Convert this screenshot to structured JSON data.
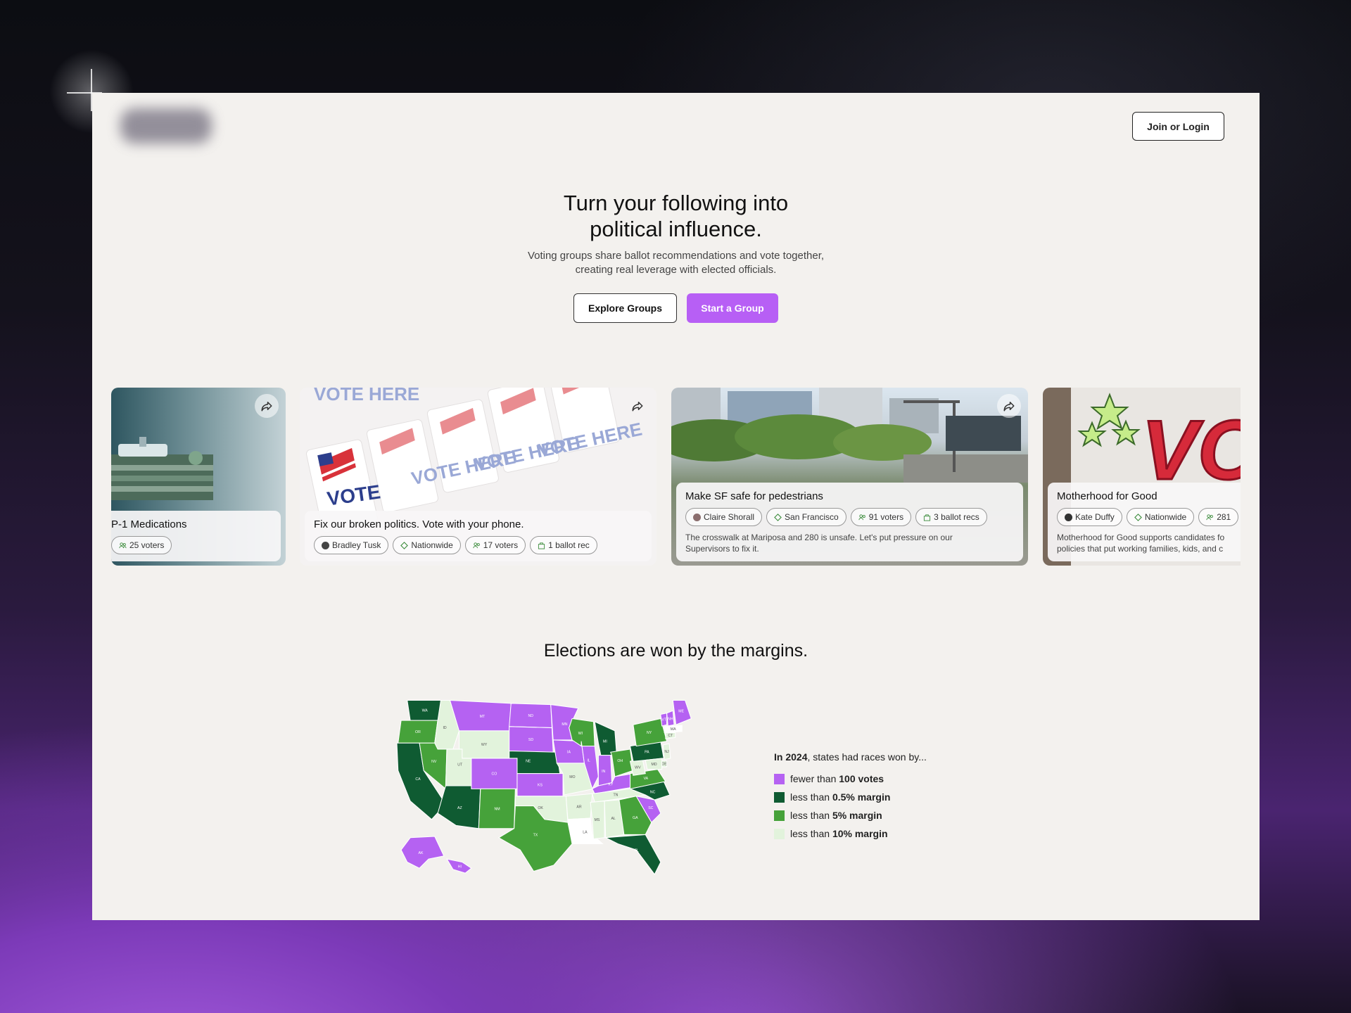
{
  "header": {
    "join_label": "Join or Login"
  },
  "hero": {
    "title_line1": "Turn your following into",
    "title_line2": "political influence.",
    "subtitle_line1": "Voting groups share ballot recommendations and vote together,",
    "subtitle_line2": "creating real leverage with elected officials.",
    "explore_label": "Explore Groups",
    "start_label": "Start a Group"
  },
  "cards": [
    {
      "title": "P-1 Medications",
      "tags": [
        "25 voters"
      ]
    },
    {
      "title": "Fix our broken politics. Vote with your phone.",
      "tags": [
        "Bradley Tusk",
        "Nationwide",
        "17 voters",
        "1 ballot rec"
      ]
    },
    {
      "title": "Make SF safe for pedestrians",
      "tags": [
        "Claire Shorall",
        "San Francisco",
        "91 voters",
        "3 ballot recs"
      ],
      "desc_line1": "The crosswalk at Mariposa and 280 is unsafe. Let's put pressure on our",
      "desc_line2": "Supervisors to fix it."
    },
    {
      "title": "Motherhood for Good",
      "tags": [
        "Kate Duffy",
        "Nationwide",
        "281"
      ],
      "desc_line1": "Motherhood for Good supports candidates fo",
      "desc_line2": "policies that put working families, kids, and c"
    }
  ],
  "vote_here": "VOTE HERE",
  "map_section": {
    "title": "Elections are won by the margins.",
    "legend_year": "In 2024",
    "legend_rest": ", states had races won by...",
    "legend": [
      {
        "prefix": "fewer than ",
        "bold": "100 votes",
        "color": "#b562f2"
      },
      {
        "prefix": "less than ",
        "bold": "0.5% margin",
        "color": "#0f5b32"
      },
      {
        "prefix": "less than ",
        "bold": "5% margin",
        "color": "#46a23a"
      },
      {
        "prefix": "less than ",
        "bold": "10% margin",
        "color": "#e2f3dc"
      }
    ],
    "states": [
      "WA",
      "OR",
      "CA",
      "NV",
      "ID",
      "MT",
      "WY",
      "UT",
      "AZ",
      "CO",
      "NM",
      "ND",
      "SD",
      "NE",
      "KS",
      "OK",
      "TX",
      "MN",
      "IA",
      "MO",
      "AR",
      "LA",
      "WI",
      "IL",
      "MI",
      "IN",
      "OH",
      "KY",
      "TN",
      "MS",
      "AL",
      "GA",
      "FL",
      "SC",
      "NC",
      "VA",
      "WV",
      "PA",
      "NY",
      "VT",
      "NH",
      "ME",
      "MA",
      "CT",
      "NJ",
      "DE",
      "MD",
      "AK",
      "HI"
    ]
  }
}
